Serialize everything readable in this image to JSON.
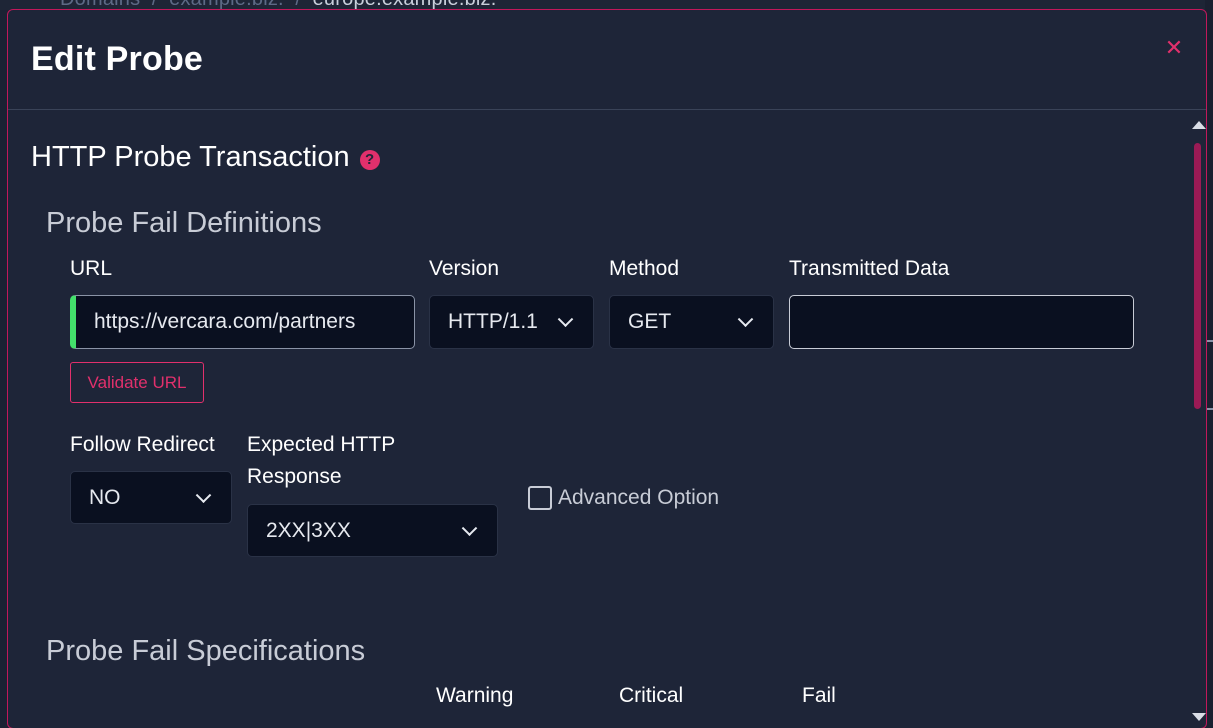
{
  "background": {
    "breadcrumb": [
      "Domains",
      "/",
      "example.biz.",
      "/",
      "europe.example.biz."
    ]
  },
  "modal": {
    "title": "Edit Probe",
    "close_icon": "close-icon",
    "section_title": "HTTP Probe Transaction",
    "help_icon": "question-circle-icon",
    "accent_color": "#e1306c",
    "fail_definitions": {
      "title": "Probe Fail Definitions",
      "url": {
        "label": "URL",
        "value": "https://vercara.com/partners"
      },
      "validate_button": "Validate URL",
      "version": {
        "label": "Version",
        "value": "HTTP/1.1"
      },
      "method": {
        "label": "Method",
        "value": "GET"
      },
      "transmitted_data": {
        "label": "Transmitted Data",
        "value": ""
      },
      "follow_redirect": {
        "label": "Follow Redirect",
        "value": "NO"
      },
      "expected_response": {
        "label_line1": "Expected HTTP",
        "label_line2": "Response",
        "value": "2XX|3XX"
      },
      "advanced_option": {
        "label": "Advanced Option",
        "checked": false
      }
    },
    "fail_specifications": {
      "title": "Probe Fail Specifications",
      "columns": [
        "Warning",
        "Critical",
        "Fail"
      ]
    }
  }
}
